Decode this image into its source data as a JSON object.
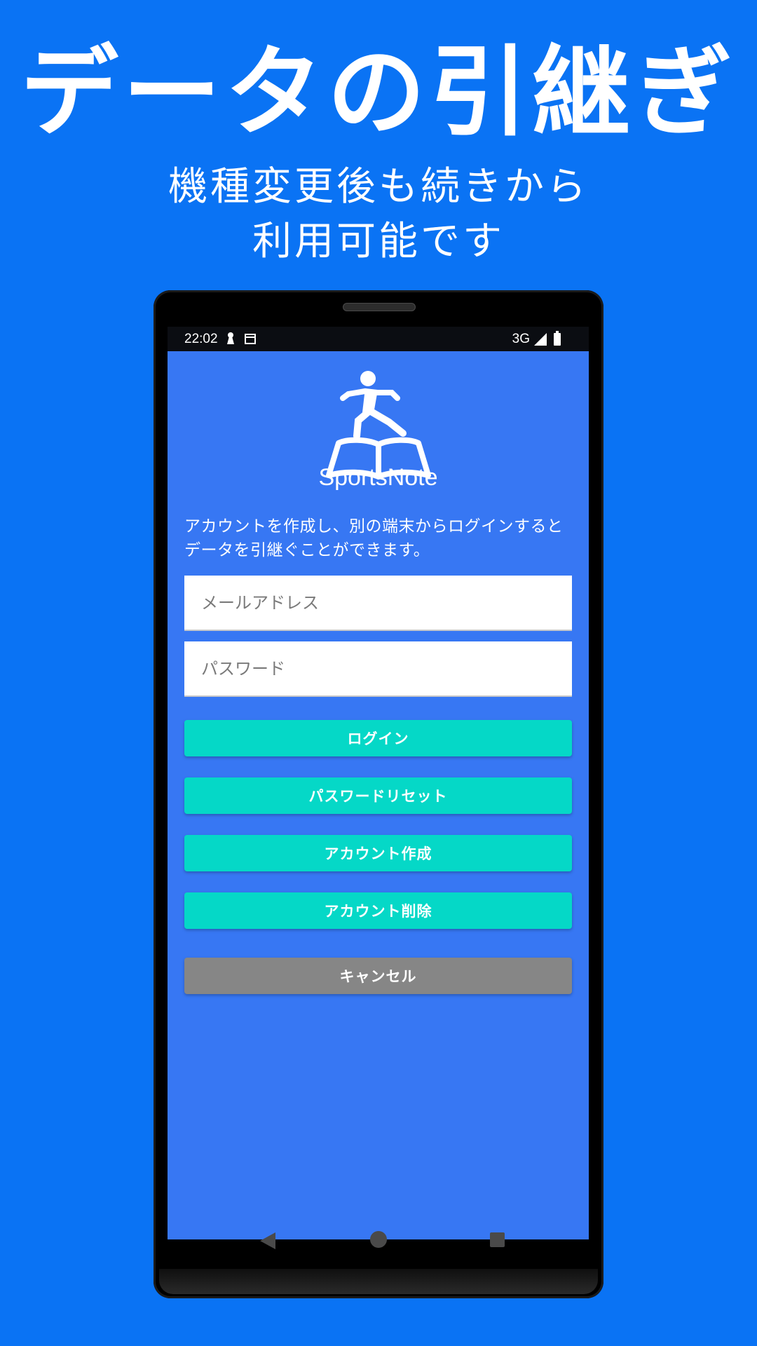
{
  "promo": {
    "headline": "データの引継ぎ",
    "subhead_line1": "機種変更後も続きから",
    "subhead_line2": "利用可能です"
  },
  "status_bar": {
    "time": "22:02",
    "network": "3G",
    "icons": [
      "keyhole-icon",
      "calendar-icon",
      "signal-icon",
      "battery-icon"
    ]
  },
  "app": {
    "name": "SportsNote",
    "logo_icon": "runner-on-book-icon",
    "description_line1": "アカウントを作成し、別の端末からログインすると",
    "description_line2": "データを引継ぐことができます。"
  },
  "form": {
    "email_placeholder": "メールアドレス",
    "email_value": "",
    "password_placeholder": "パスワード",
    "password_value": ""
  },
  "buttons": {
    "login": "ログイン",
    "password_reset": "パスワードリセット",
    "create_account": "アカウント作成",
    "delete_account": "アカウント削除",
    "cancel": "キャンセル"
  },
  "nav_bar": {
    "icons": [
      "back-icon",
      "home-icon",
      "recents-icon"
    ]
  },
  "colors": {
    "background": "#0a73f4",
    "screen": "#3777f3",
    "button_primary": "#05d8c7",
    "button_cancel": "#868686"
  }
}
